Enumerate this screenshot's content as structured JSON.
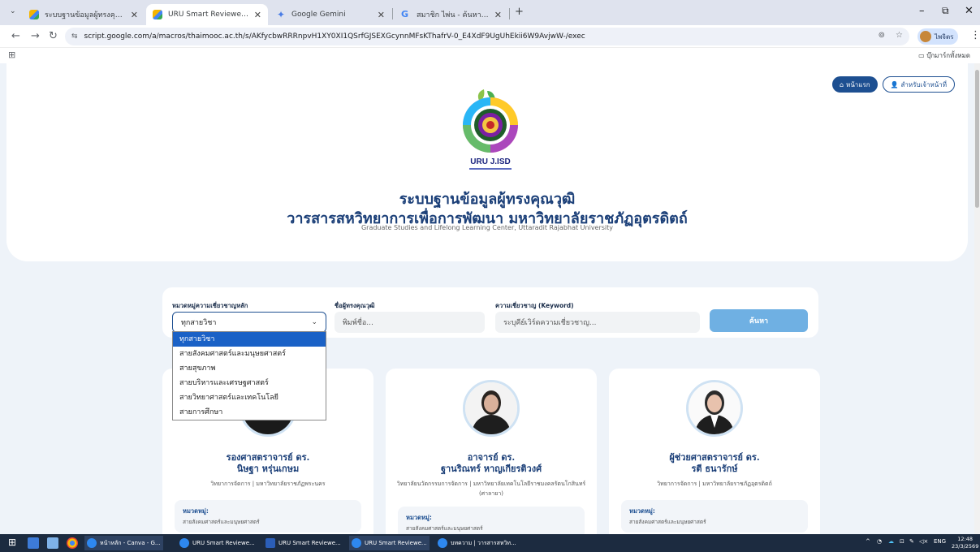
{
  "browser": {
    "tabs": [
      {
        "title": "ระบบฐานข้อมูลผู้ทรงคุณวุฒิ วารสาร...",
        "icon": "uru-icon",
        "active": false
      },
      {
        "title": "URU Smart Reviewer Hub",
        "icon": "uru-icon",
        "active": true
      },
      {
        "title": "Google Gemini",
        "icon": "gemini-icon",
        "active": false
      },
      {
        "title": "สมาชิก ไพ่น - ค้นหาด้วย Google",
        "icon": "google-icon",
        "active": false
      }
    ],
    "new_tab": "+",
    "site_info": "⇆",
    "url": "script.google.com/a/macros/thaimooc.ac.th/s/AKfycbwRRRnpvH1XY0XI1QSrfGJSEXGcynnMFsKThafrV-0_E4XdF9UgUhEkii6W9AvjwW-/exec",
    "profile_name": "ไพจิตร",
    "bookmarks_folder": "บุ๊กมาร์กทั้งหมด"
  },
  "nav": {
    "home": "หน้าแรก",
    "admin": "สำหรับเจ้าหน้าที่"
  },
  "header": {
    "logo_text": "URU J.ISD",
    "title_line1": "ระบบฐานข้อมูลผู้ทรงคุณวุฒิ",
    "title_line2": "วารสารสหวิทยาการเพื่อการพัฒนา มหาวิทยาลัยราชภัฏอุตรดิตถ์",
    "subtitle": "Graduate Studies and Lifelong Learning Center, Uttaradit Rajabhat University"
  },
  "search": {
    "category_label": "หมวดหมู่ความเชี่ยวชาญหลัก",
    "category_value": "ทุกสายวิชา",
    "name_label": "ชื่อผู้ทรงคุณวุฒิ",
    "name_placeholder": "พิมพ์ชื่อ...",
    "keyword_label": "ความเชี่ยวชาญ (Keyword)",
    "keyword_placeholder": "ระบุคีย์เวิร์ดความเชี่ยวชาญ...",
    "button": "ค้นหา",
    "options": [
      "ทุกสายวิชา",
      "สายสังคมศาสตร์และมนุษยศาสตร์",
      "สายสุขภาพ",
      "สายบริหารและเศรษฐศาสตร์",
      "สายวิทยาศาสตร์และเทคโนโลยี",
      "สายการศึกษา"
    ],
    "highlighted_option": 0
  },
  "cards": [
    {
      "title": "รองศาสตราจารย์ ดร.",
      "name": "นิษฐา หรุ่นเกษม",
      "affiliation": "วิทยาการจัดการ | มหาวิทยาลัยราชภัฏพระนคร",
      "category_label": "หมวดหมู่:",
      "category": "สายสังคมศาสตร์และมนุษยศาสตร์"
    },
    {
      "title": "อาจารย์ ดร.",
      "name": "ฐานริณทร์ หาญเกียรติวงศ์",
      "affiliation": "วิทยาลัยนวัตกรรมการจัดการ | มหาวิทยาลัยเทคโนโลยีราชมงคลรัตนโกสินทร์ (ศาลายา)",
      "category_label": "หมวดหมู่:",
      "category": "สายสังคมศาสตร์และมนุษยศาสตร์"
    },
    {
      "title": "ผู้ช่วยศาสตราจารย์ ดร.",
      "name": "รตี ธนารักษ์",
      "affiliation": "วิทยาการจัดการ | มหาวิทยาลัยราชภัฏอุตรดิตถ์",
      "category_label": "หมวดหมู่:",
      "category": "สายสังคมศาสตร์และมนุษยศาสตร์"
    }
  ],
  "taskbar": {
    "apps": [
      {
        "label": "หน้าหลัก - Canva - G...",
        "color": "#2e88f0"
      },
      {
        "label": "URU Smart Reviewe...",
        "color": "#2e88f0"
      },
      {
        "label": "URU Smart Reviewe...",
        "color": "#2b5eb8"
      },
      {
        "label": "URU Smart Reviewe...",
        "color": "#2e88f0"
      },
      {
        "label": "บทความ | วารสารสหวิท...",
        "color": "#2e88f0"
      }
    ],
    "lang": "ENG",
    "time": "12:48",
    "date": "23/3/2569"
  },
  "colors": {
    "brand": "#1b3f78",
    "accent": "#1d4f91",
    "search_button": "#6fb0e3",
    "page_bg": "#eef3f9"
  }
}
